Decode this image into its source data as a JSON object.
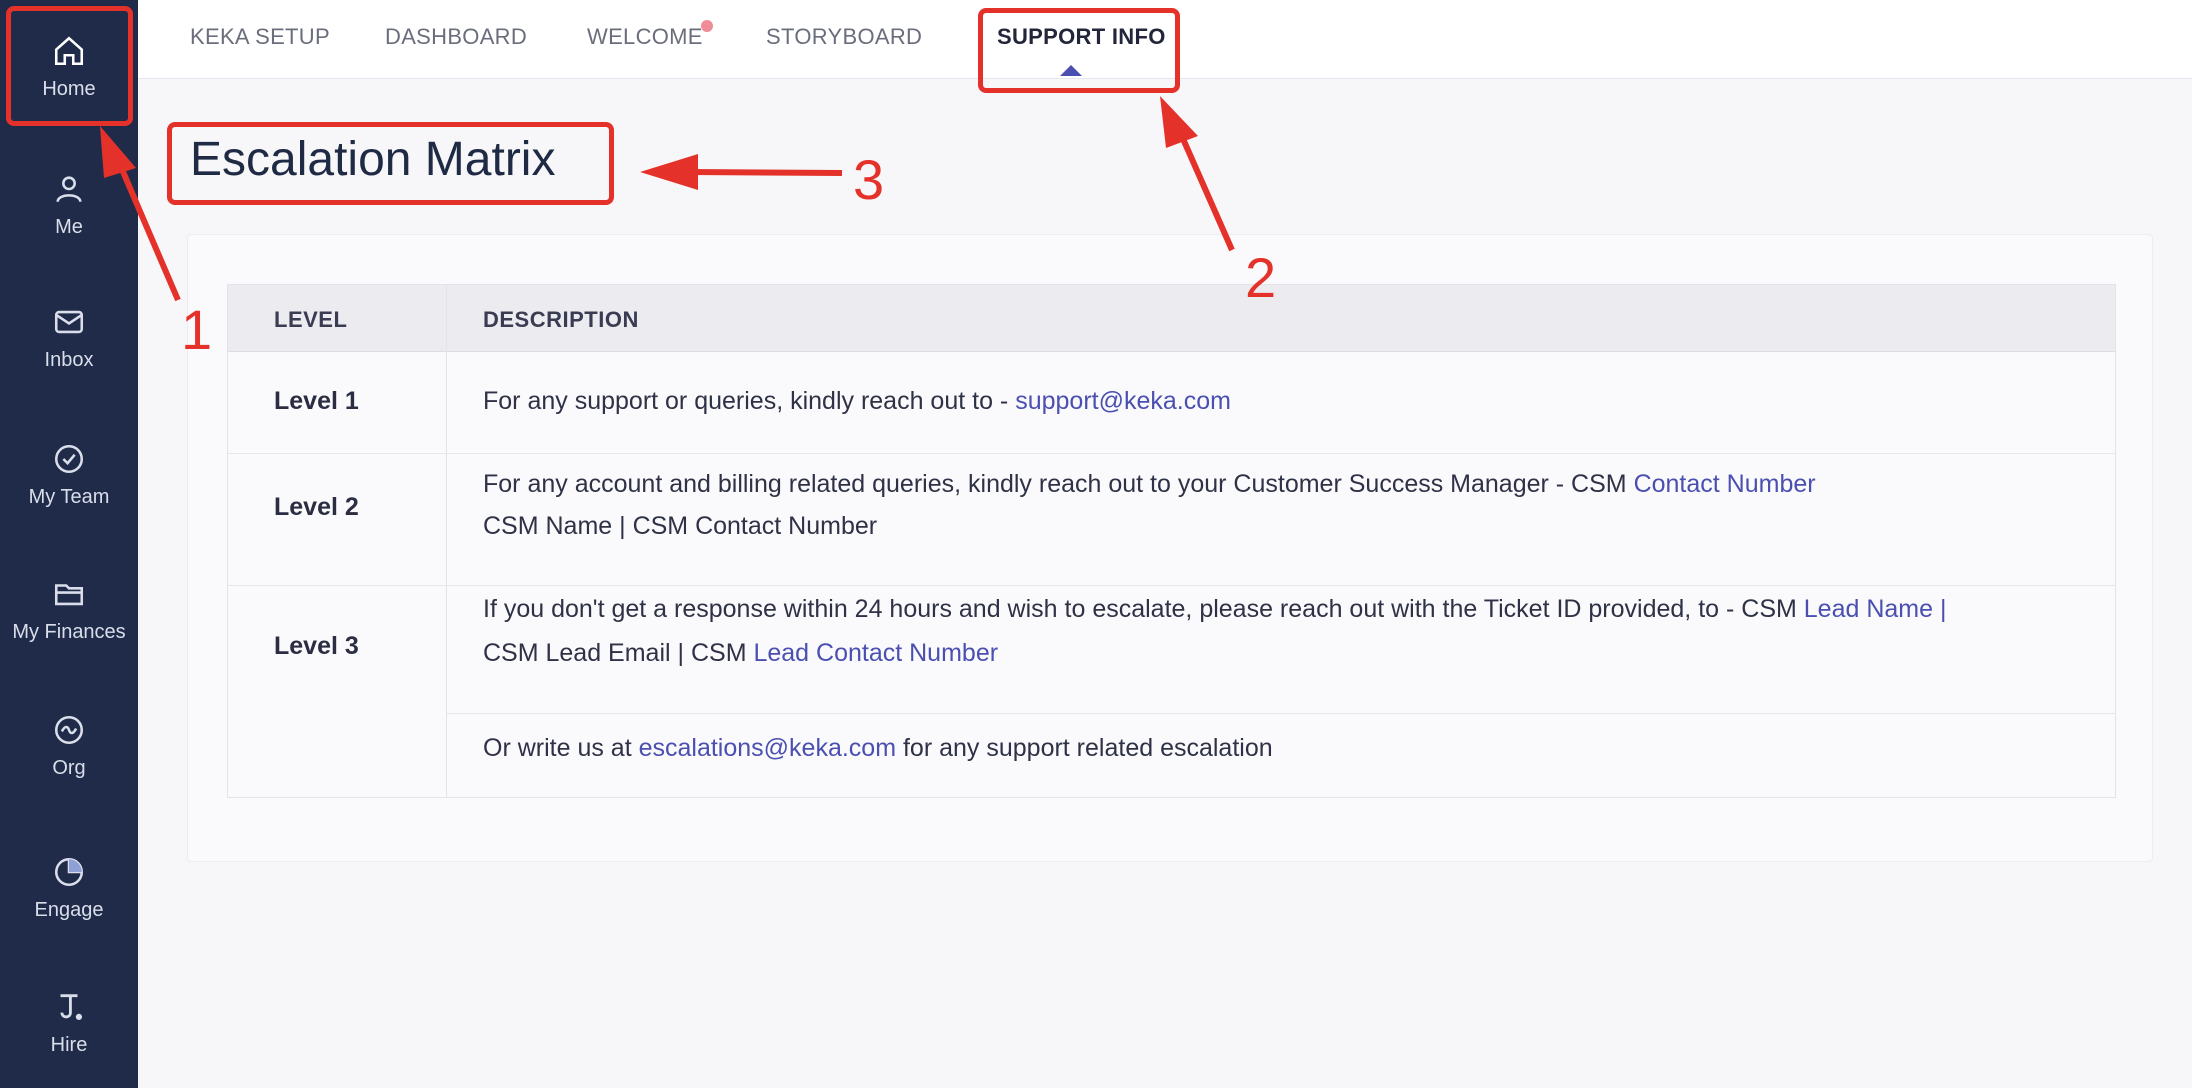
{
  "sidebar": {
    "items": [
      {
        "label": "Home",
        "icon": "home-icon"
      },
      {
        "label": "Me",
        "icon": "user-icon"
      },
      {
        "label": "Inbox",
        "icon": "mail-icon"
      },
      {
        "label": "My Team",
        "icon": "check-circle-icon"
      },
      {
        "label": "My Finances",
        "icon": "folder-icon"
      },
      {
        "label": "Org",
        "icon": "org-icon"
      },
      {
        "label": "Engage",
        "icon": "pie-icon"
      },
      {
        "label": "Hire",
        "icon": "hire-icon"
      }
    ]
  },
  "tabs": [
    {
      "label": "KEKA SETUP"
    },
    {
      "label": "DASHBOARD"
    },
    {
      "label": "WELCOME"
    },
    {
      "label": "STORYBOARD"
    },
    {
      "label": "SUPPORT INFO",
      "active": true
    }
  ],
  "page": {
    "title": "Escalation Matrix"
  },
  "table": {
    "headers": {
      "level": "LEVEL",
      "description": "DESCRIPTION"
    },
    "rows": [
      {
        "level": "Level 1",
        "line1_text": "For any support or queries, kindly reach out to - ",
        "line1_link": "support@keka.com"
      },
      {
        "level": "Level 2",
        "line1_text": "For any account and billing related queries, kindly reach out to your Customer Success Manager - CSM ",
        "line1_link": "Contact Number",
        "line2_text": "CSM Name | CSM Contact Number"
      },
      {
        "level": "Level 3",
        "line1_text": "If you don't get a response within 24 hours and wish to escalate, please reach out with the Ticket ID provided, to - CSM ",
        "line1_link": "Lead Name  |",
        "line2_text": "CSM Lead Email | CSM ",
        "line2_link": "Lead Contact Number",
        "extra_prefix": "Or write us at ",
        "extra_link": "escalations@keka.com",
        "extra_suffix": " for any support related escalation"
      }
    ]
  },
  "annotations": {
    "color": "#e4322b",
    "labels": [
      "1",
      "2",
      "3"
    ]
  },
  "colors": {
    "sidebar": "#1f2b49",
    "link": "#4a4fb0",
    "notification_dot": "#ef8c97"
  }
}
